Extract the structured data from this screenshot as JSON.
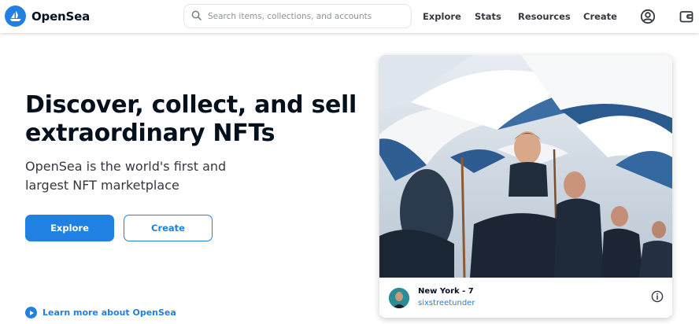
{
  "brand": {
    "name": "OpenSea",
    "accent_color": "#2081e2"
  },
  "search": {
    "placeholder": "Search items, collections, and accounts",
    "icon": "search-icon"
  },
  "nav": {
    "links": [
      "Explore",
      "Stats",
      "Resources",
      "Create"
    ],
    "icons": [
      "account-circle-icon",
      "wallet-icon"
    ]
  },
  "hero": {
    "headline": "Discover, collect, and sell extraordinary NFTs",
    "subline": "OpenSea is the world's first and largest NFT marketplace",
    "buttons": {
      "primary": "Explore",
      "secondary": "Create"
    },
    "learn_more": "Learn more about OpenSea",
    "learn_more_icon": "play-circle-icon"
  },
  "featured": {
    "title": "New York - 7",
    "creator": "sixstreetunder",
    "image_subject": "umbrellas-crowd-photo",
    "info_icon": "info-icon"
  }
}
